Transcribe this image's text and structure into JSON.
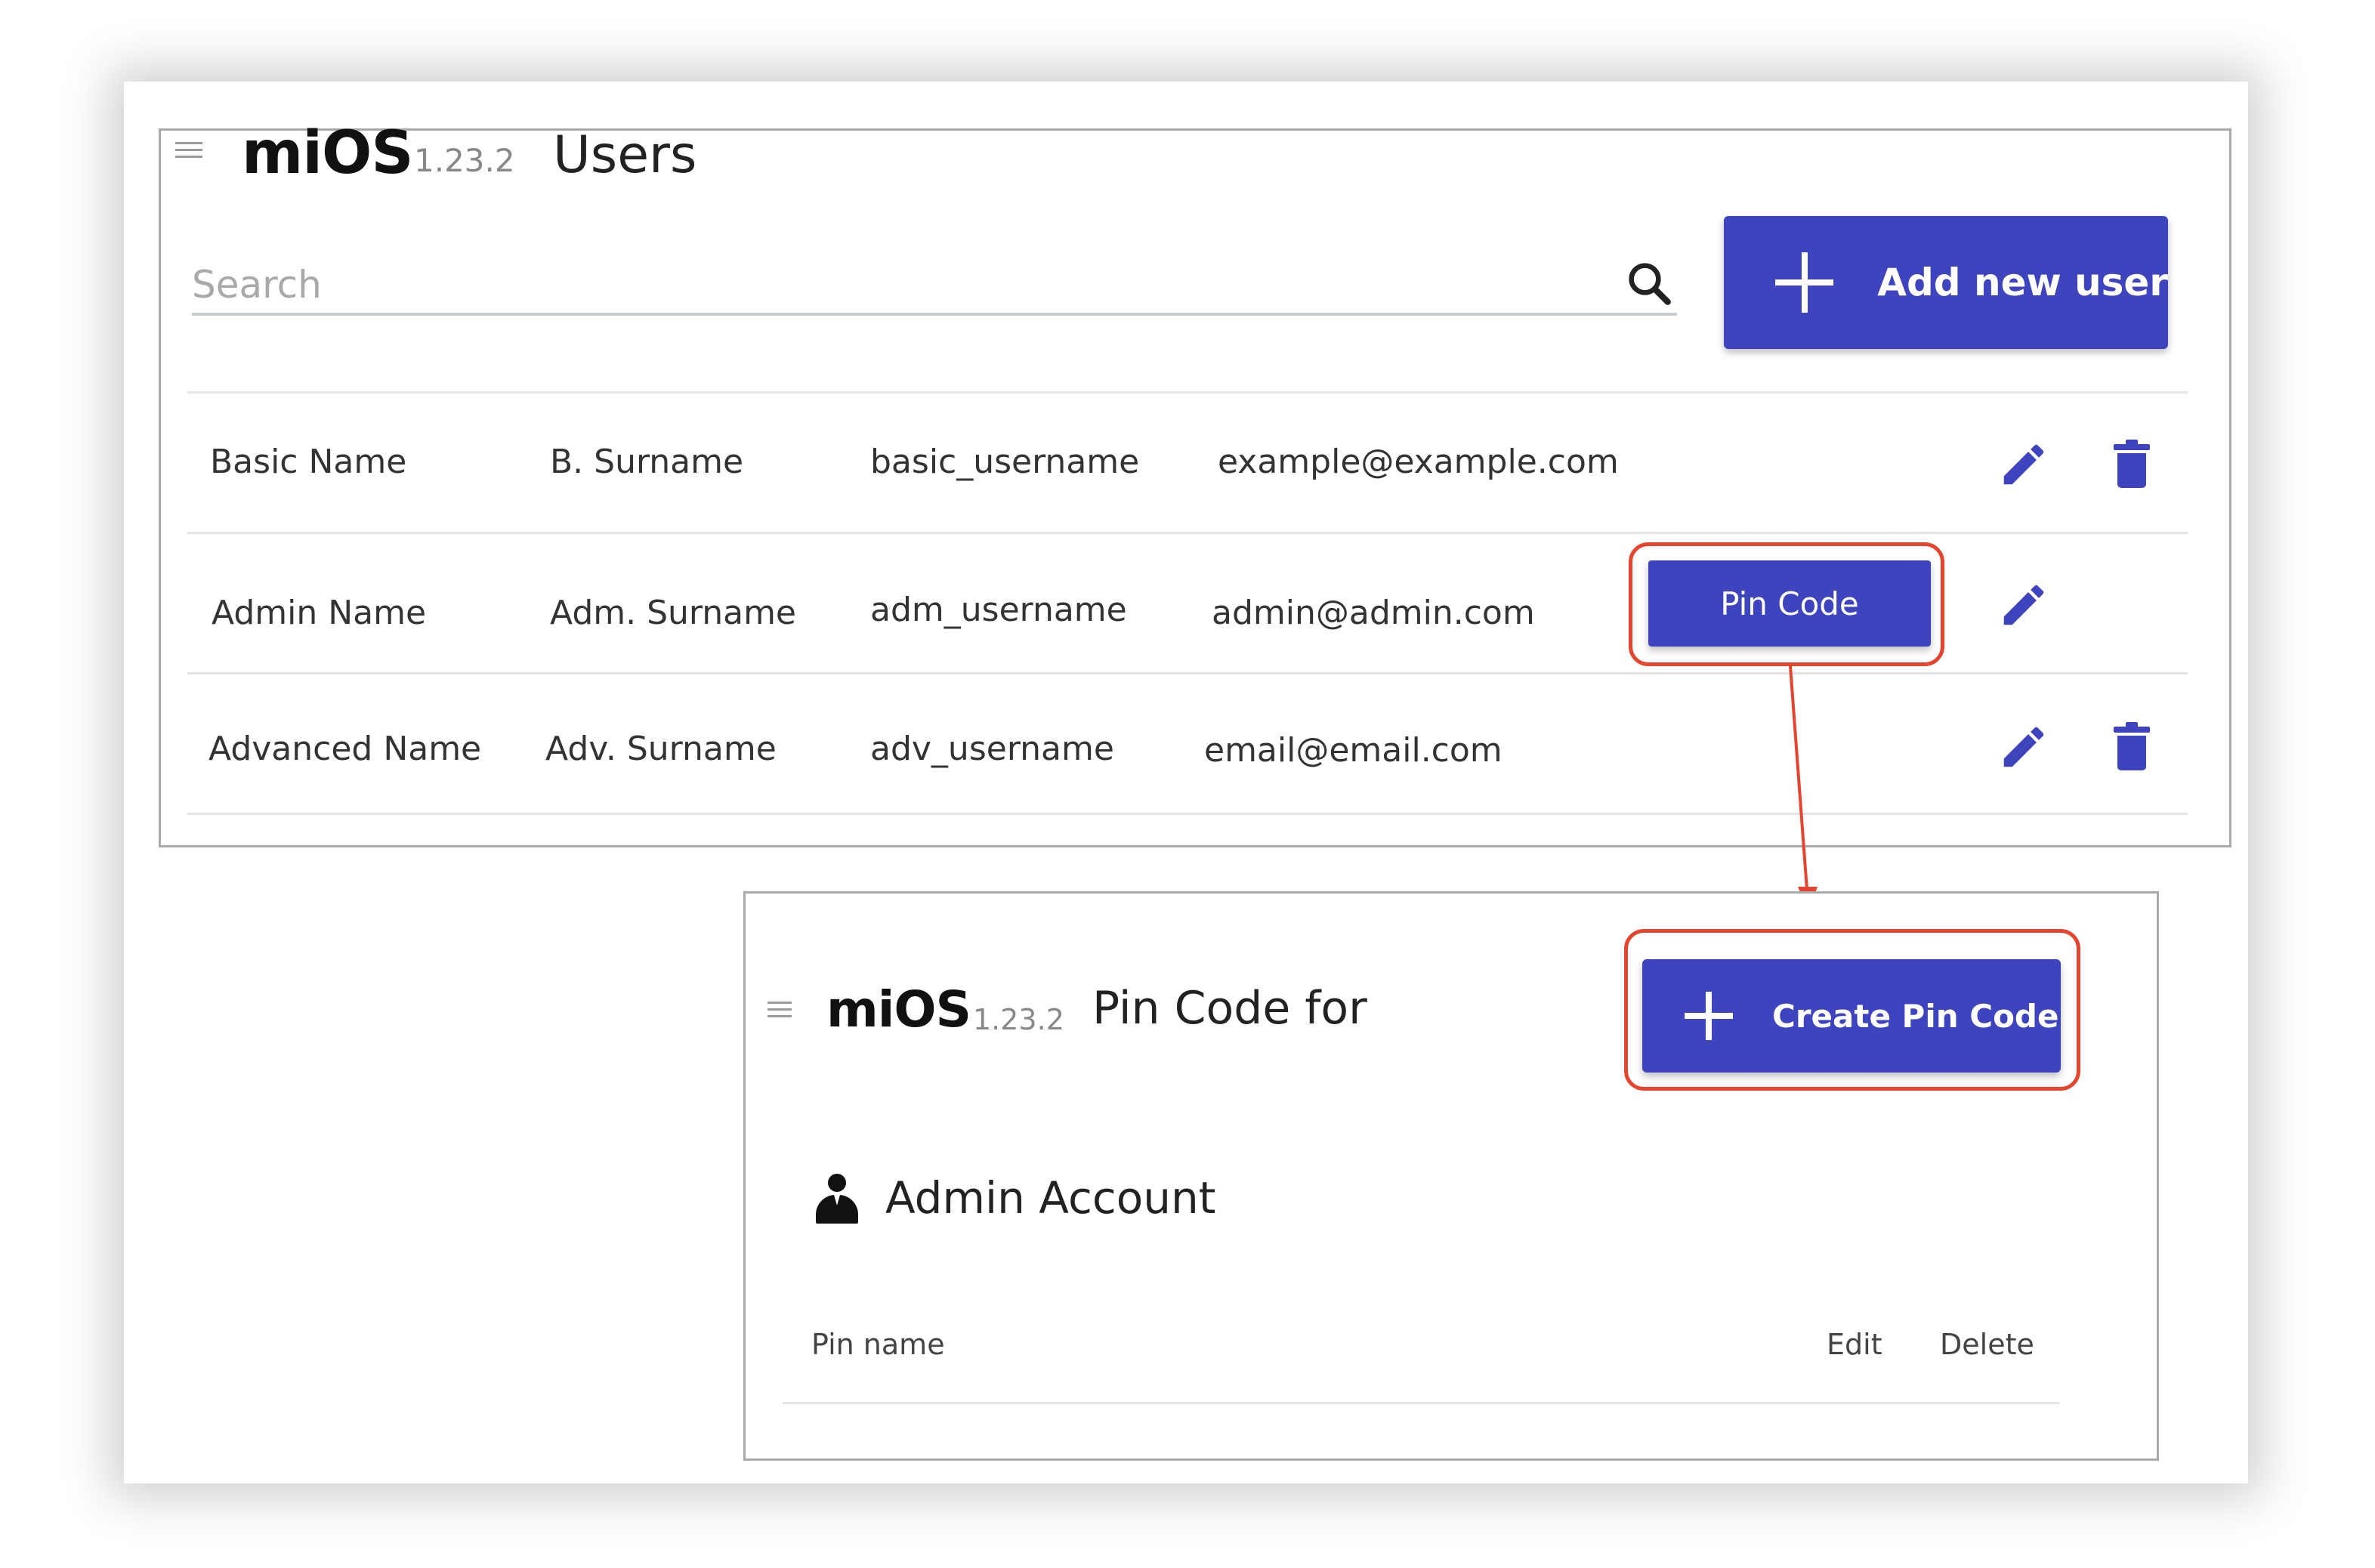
{
  "users_screen": {
    "brand": "miOS",
    "version": "1.23.2",
    "title": "Users",
    "search": {
      "placeholder": "Search",
      "icon": "search-icon"
    },
    "add_button_label": "Add new user",
    "rows": [
      {
        "name": "Basic Name",
        "surname": "B. Surname",
        "username": "basic_username",
        "email": "example@example.com",
        "has_pin_button": false,
        "has_delete": true
      },
      {
        "name": "Admin Name",
        "surname": "Adm. Surname",
        "username": "adm_username",
        "email": "admin@admin.com",
        "has_pin_button": true,
        "pin_button_label": "Pin Code",
        "has_delete": false
      },
      {
        "name": "Advanced Name",
        "surname": "Adv. Surname",
        "username": "adv_username",
        "email": "email@email.com",
        "has_pin_button": false,
        "has_delete": true
      }
    ]
  },
  "pin_screen": {
    "brand": "miOS",
    "version": "1.23.2",
    "title": "Pin Code for",
    "create_button_label": "Create Pin Code",
    "account_label": "Admin Account",
    "columns": [
      "Pin name",
      "Edit",
      "Delete"
    ]
  },
  "colors": {
    "accent": "#3d44bd",
    "highlight": "#e3452f",
    "divider": "#e4e4e4"
  }
}
